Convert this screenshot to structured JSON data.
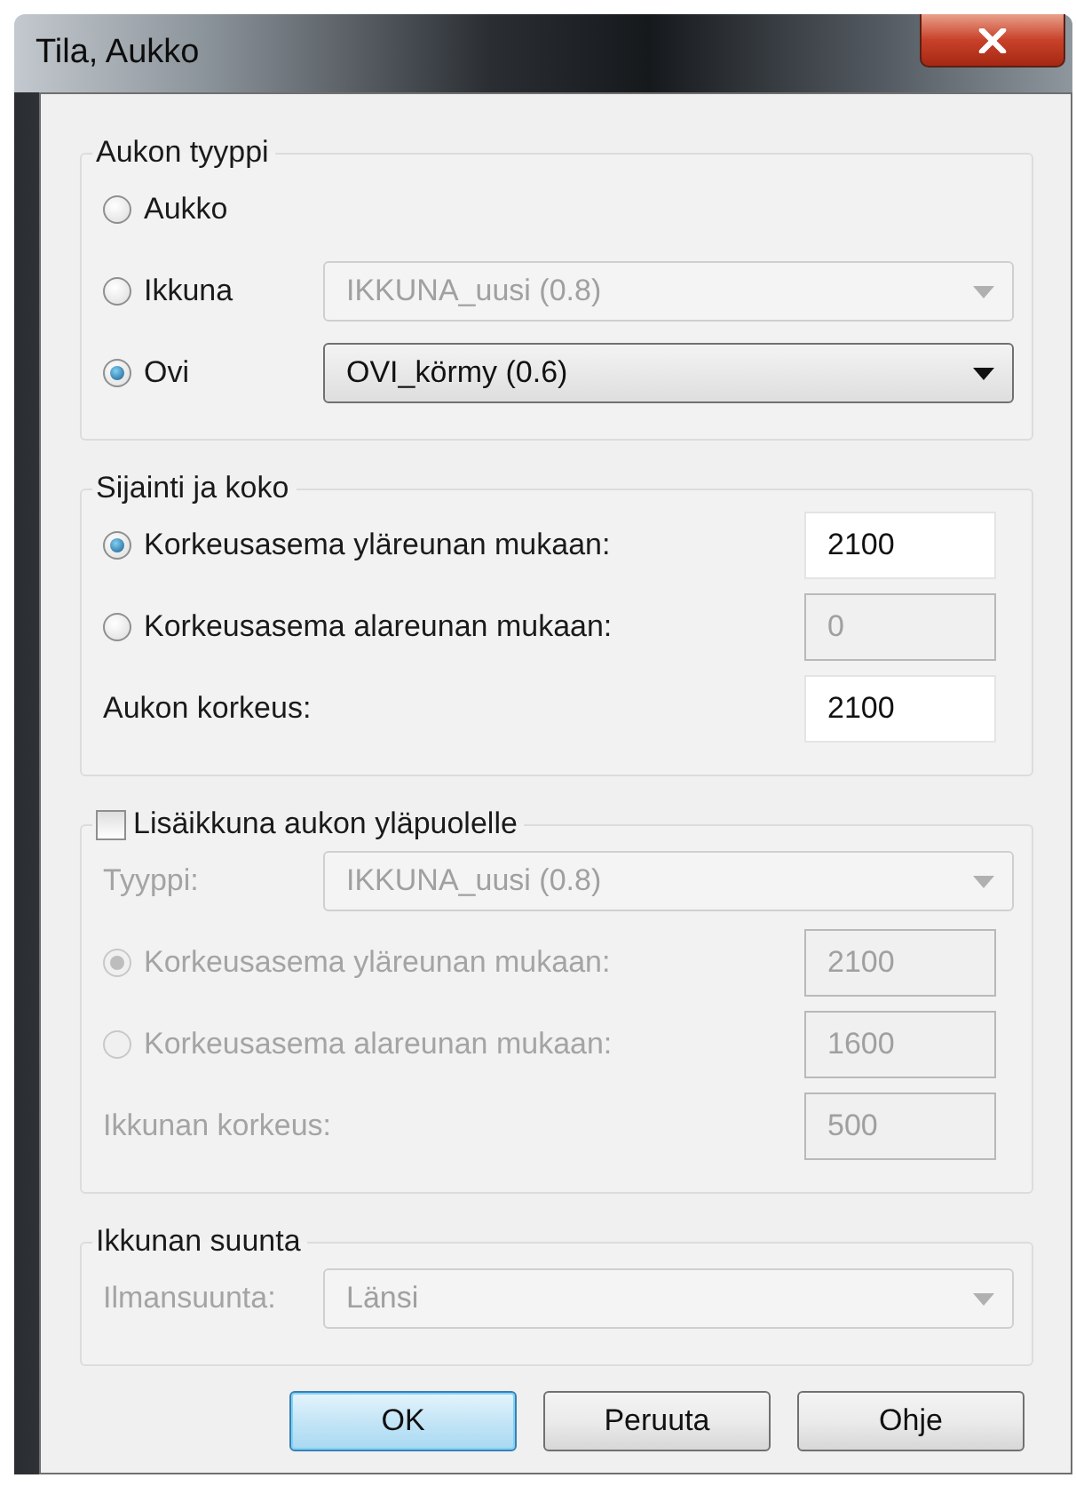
{
  "window": {
    "title": "Tila, Aukko"
  },
  "groups": [
    {
      "kind": "plain",
      "legend": "Aukon tyyppi",
      "rows": [
        {
          "kind": "radio",
          "label": "Aukko",
          "selected": false,
          "disabled": false
        },
        {
          "kind": "radio",
          "label": "Ikkuna",
          "selected": false,
          "disabled": false,
          "combo": {
            "value": "IKKUNA_uusi (0.8)",
            "disabled": true
          }
        },
        {
          "kind": "radio",
          "label": "Ovi",
          "selected": true,
          "disabled": false,
          "combo": {
            "value": "OVI_körmy (0.6)",
            "disabled": false
          }
        }
      ]
    },
    {
      "kind": "plain",
      "legend": "Sijainti ja koko",
      "rows": [
        {
          "kind": "radio",
          "label": "Korkeusasema yläreunan mukaan:",
          "selected": true,
          "disabled": false,
          "input": {
            "value": "2100",
            "disabled": false
          }
        },
        {
          "kind": "radio",
          "label": "Korkeusasema alareunan mukaan:",
          "selected": false,
          "disabled": false,
          "input": {
            "value": "0",
            "disabled": true
          }
        },
        {
          "kind": "label",
          "label": "Aukon korkeus:",
          "disabled": false,
          "input": {
            "value": "2100",
            "disabled": false
          }
        }
      ]
    },
    {
      "kind": "checkbox",
      "legend": "Lisäikkuna aukon yläpuolelle",
      "checked": false,
      "rows": [
        {
          "kind": "label",
          "label": "Tyyppi:",
          "disabled": true,
          "combo": {
            "value": "IKKUNA_uusi (0.8)",
            "disabled": true
          }
        },
        {
          "kind": "radio",
          "label": "Korkeusasema yläreunan mukaan:",
          "selected": true,
          "disabled": true,
          "input": {
            "value": "2100",
            "disabled": true
          }
        },
        {
          "kind": "radio",
          "label": "Korkeusasema alareunan mukaan:",
          "selected": false,
          "disabled": true,
          "input": {
            "value": "1600",
            "disabled": true
          }
        },
        {
          "kind": "label",
          "label": "Ikkunan korkeus:",
          "disabled": true,
          "input": {
            "value": "500",
            "disabled": true
          }
        }
      ]
    },
    {
      "kind": "plain",
      "legend": "Ikkunan suunta",
      "rows": [
        {
          "kind": "label",
          "label": "Ilmansuunta:",
          "disabled": true,
          "combo": {
            "value": "Länsi",
            "disabled": true
          }
        }
      ]
    }
  ],
  "buttons": [
    {
      "label": "OK",
      "default": true
    },
    {
      "label": "Peruuta",
      "default": false
    },
    {
      "label": "Ohje",
      "default": false
    }
  ]
}
